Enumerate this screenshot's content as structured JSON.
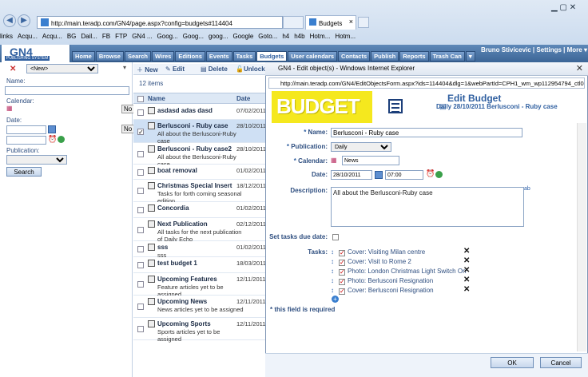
{
  "browser": {
    "url": "http://main.teradp.com/GN4/page.aspx?config=budgets#114404",
    "tab_label": "Budgets",
    "favorites": [
      "links",
      "Acqu...",
      "Acqu...",
      "BG",
      "Dail...",
      "FB",
      "FTP",
      "GN4 ...",
      "Goog...",
      "Goog...",
      "goog...",
      "Google",
      "Goto...",
      "h4",
      "h4b",
      "Hotm...",
      "Hotm..."
    ]
  },
  "app": {
    "logo": "GN4",
    "logo_sub": "PUBLISHING SYSTEM",
    "menu": [
      "Home",
      "Browse",
      "Search",
      "Wires",
      "Editions",
      "Events",
      "Tasks",
      "Budgets",
      "User calendars",
      "Contacts",
      "Publish",
      "Reports",
      "Trash Can",
      "▾"
    ],
    "active_menu": "Budgets",
    "user": "Bruno Stivicevic",
    "settings": "Settings",
    "more": "More ▾"
  },
  "filter": {
    "new_option": "<New>",
    "name_label": "Name:",
    "calendar_label": "Calendar:",
    "date_label": "Date:",
    "publication_label": "Publication:",
    "search_button": "Search",
    "no_1": "No",
    "no_2": "No"
  },
  "list": {
    "toolbar": {
      "new": "New",
      "edit": "Edit",
      "delete": "Delete",
      "unlock": "Unlock"
    },
    "count": "12 items",
    "col_name": "Name",
    "col_date": "Date",
    "rows": [
      {
        "title": "asdasd adas dasd",
        "desc": "",
        "date": "07/02/2011"
      },
      {
        "title": "Berlusconi - Ruby case",
        "desc": "All about the Berlusconi-Ruby case",
        "date": "28/10/2011"
      },
      {
        "title": "Berlusconi - Ruby case2",
        "desc": "All about the Berlusconi-Ruby case",
        "date": "28/10/2011"
      },
      {
        "title": "boat removal",
        "desc": "",
        "date": "01/02/2011"
      },
      {
        "title": "Christmas Special Insert",
        "desc": "Tasks for forth coming seasonal edition",
        "date": "18/12/2011"
      },
      {
        "title": "Concordia",
        "desc": "",
        "date": "01/02/2011"
      },
      {
        "title": "Next Publication",
        "desc": "All tasks for the next publication of Daily Echo",
        "date": "02/12/2011"
      },
      {
        "title": "sss",
        "desc": "sss",
        "date": "01/02/2011"
      },
      {
        "title": "test budget 1",
        "desc": "",
        "date": "18/03/2011"
      },
      {
        "title": "Upcoming Features",
        "desc": "Feature articles yet to be assigned",
        "date": "12/11/2011"
      },
      {
        "title": "Upcoming News",
        "desc": "News articles yet to be assigned",
        "date": "12/11/2011"
      },
      {
        "title": "Upcoming Sports",
        "desc": "Sports articles yet to be assigned",
        "date": "12/11/2011"
      }
    ]
  },
  "dialog": {
    "title": "GN4 - Edit object(s) - Windows Internet Explorer",
    "url": "http://main.teradp.com/GN4/EditObjectsForm.aspx?ids=114404&dlg=1&webPartId=CPH1_wm_wp112954794_ctl04",
    "banner_word": "BUDGET",
    "heading": "Edit Budget",
    "subheading": "Daily 28/10/2011 Berlusconi - Ruby case",
    "name_label": "Name:",
    "name_value": "Berlusconi - Ruby case",
    "publication_label": "Publication:",
    "publication_value": "Daily",
    "calendar_label": "Calendar:",
    "calendar_value": "News",
    "date_label": "Date:",
    "date_value": "28/10/2011",
    "time_value": "07:00",
    "description_label": "Description:",
    "description_value": "All about the Berlusconi-Ruby case",
    "due_label": "Set tasks due date:",
    "tasks_label": "Tasks:",
    "tasks": [
      "Cover: Visiting Milan centre",
      "Cover: Visit to Rome 2",
      "Photo: London Christmas Light Switch On",
      "Photo: Berlusconi Resignation",
      "Cover: Berlusconi Resignation"
    ],
    "required_note": "* this field is required",
    "ok": "OK",
    "cancel": "Cancel"
  }
}
